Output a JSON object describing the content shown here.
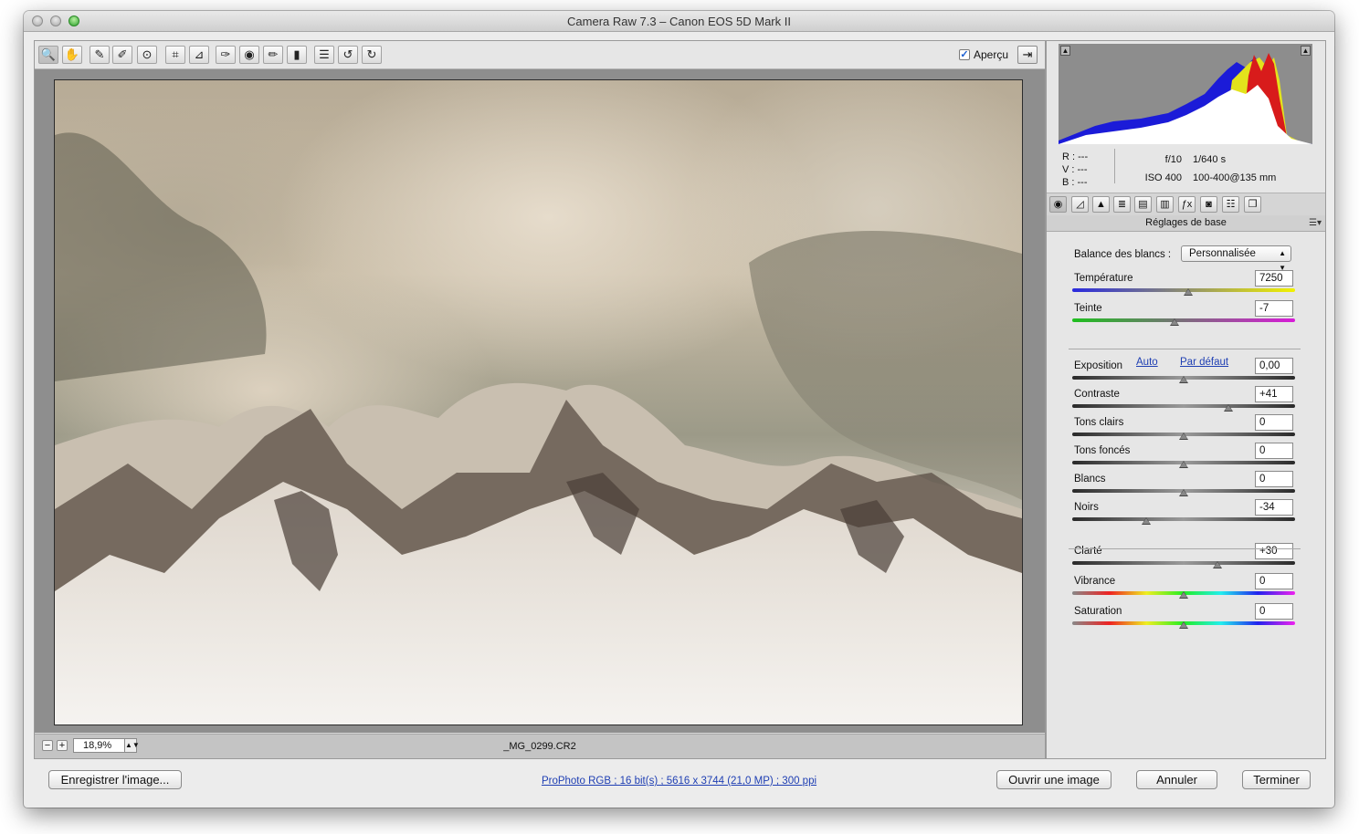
{
  "window": {
    "title": "Camera Raw 7.3  –  Canon EOS 5D Mark II"
  },
  "toolbar": {
    "tools": [
      {
        "name": "zoom-tool",
        "icon": "magnifier-icon",
        "glyph": "🔍"
      },
      {
        "name": "hand-tool",
        "icon": "hand-icon",
        "glyph": "✋"
      },
      {
        "name": "white-balance-tool",
        "icon": "eyedropper-icon",
        "glyph": "✎"
      },
      {
        "name": "color-sampler-tool",
        "icon": "color-sampler-icon",
        "glyph": "✐"
      },
      {
        "name": "target-adjustment-tool",
        "icon": "target-adjust-icon",
        "glyph": "⊙"
      },
      {
        "name": "crop-tool",
        "icon": "crop-icon",
        "glyph": "⌗"
      },
      {
        "name": "straighten-tool",
        "icon": "straighten-icon",
        "glyph": "⊿"
      },
      {
        "name": "spot-removal-tool",
        "icon": "spot-removal-icon",
        "glyph": "✑"
      },
      {
        "name": "red-eye-tool",
        "icon": "red-eye-icon",
        "glyph": "◉"
      },
      {
        "name": "adjustment-brush-tool",
        "icon": "brush-icon",
        "glyph": "✏"
      },
      {
        "name": "graduated-filter-tool",
        "icon": "graduated-filter-icon",
        "glyph": "▮"
      },
      {
        "name": "preferences-tool",
        "icon": "list-icon",
        "glyph": "☰"
      },
      {
        "name": "rotate-left-tool",
        "icon": "rotate-ccw-icon",
        "glyph": "↺"
      },
      {
        "name": "rotate-right-tool",
        "icon": "rotate-cw-icon",
        "glyph": "↻"
      }
    ],
    "preview_label": "Aperçu",
    "preview_checked": true
  },
  "status": {
    "zoom": "18,9%",
    "filename": "_MG_0299.CR2"
  },
  "info": {
    "r": "R :  ---",
    "v": "V :  ---",
    "b": "B :  ---",
    "aperture": "f/10",
    "shutter": "1/640 s",
    "iso": "ISO 400",
    "lens": "100-400@135 mm"
  },
  "panel": {
    "section_title": "Réglages de base",
    "wb_label": "Balance des blancs :",
    "wb_value": "Personnalisée",
    "auto_link": "Auto",
    "default_link": "Par défaut",
    "sliders": [
      {
        "label": "Température",
        "value": "7250",
        "level": 0.52
      },
      {
        "label": "Teinte",
        "value": "-7",
        "level": 0.46
      },
      {
        "label": "Exposition",
        "value": "0,00",
        "level": 0.5
      },
      {
        "label": "Contraste",
        "value": "+41",
        "level": 0.7
      },
      {
        "label": "Tons clairs",
        "value": "0",
        "level": 0.5
      },
      {
        "label": "Tons foncés",
        "value": "0",
        "level": 0.5
      },
      {
        "label": "Blancs",
        "value": "0",
        "level": 0.5
      },
      {
        "label": "Noirs",
        "value": "-34",
        "level": 0.33
      },
      {
        "label": "Clarté",
        "value": "+30",
        "level": 0.65
      },
      {
        "label": "Vibrance",
        "value": "0",
        "level": 0.5
      },
      {
        "label": "Saturation",
        "value": "0",
        "level": 0.5
      }
    ]
  },
  "bottom": {
    "save_label": "Enregistrer l'image...",
    "workflow_link": "ProPhoto RGB ; 16 bit(s) ; 5616 x 3744 (21,0 MP) ; 300 ppi",
    "open_label": "Ouvrir une image",
    "cancel_label": "Annuler",
    "done_label": "Terminer"
  }
}
